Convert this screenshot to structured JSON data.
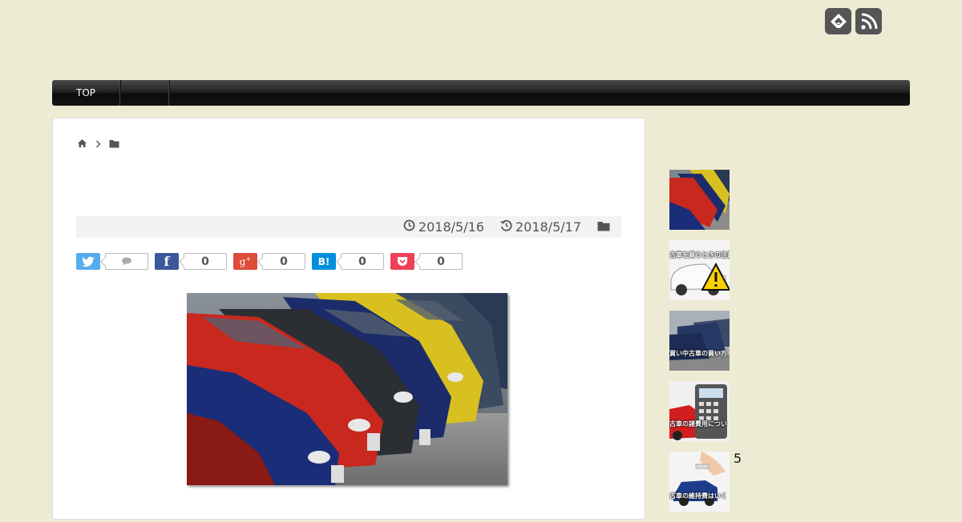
{
  "header": {
    "icons": [
      "feedly-icon",
      "rss-icon"
    ]
  },
  "nav": {
    "items": [
      {
        "label": "TOP"
      },
      {
        "label": ""
      }
    ]
  },
  "breadcrumb": {
    "icons": [
      "home-icon",
      "chevron-right-icon",
      "folder-icon"
    ]
  },
  "meta": {
    "published": "2018/5/16",
    "updated": "2018/5/17"
  },
  "share": {
    "twitter_count": "",
    "facebook_count": "0",
    "googleplus_count": "0",
    "hatena_count": "0",
    "pocket_count": "0",
    "colors": {
      "twitter": "#55acee",
      "facebook": "#3b5998",
      "googleplus": "#dd4b39",
      "hatena": "#008fde",
      "pocket": "#ee4056"
    }
  },
  "sidebar": {
    "thumbs": [
      {
        "caption": ""
      },
      {
        "caption": "古車を買うときの注意"
      },
      {
        "caption": "買い中古車の買い方"
      },
      {
        "caption": "古車の諸費用につい"
      },
      {
        "caption": "古車の維持費はいく"
      }
    ],
    "rank_label": "5"
  },
  "colors": {
    "background": "#eeebd4",
    "navbar": "#111111"
  }
}
